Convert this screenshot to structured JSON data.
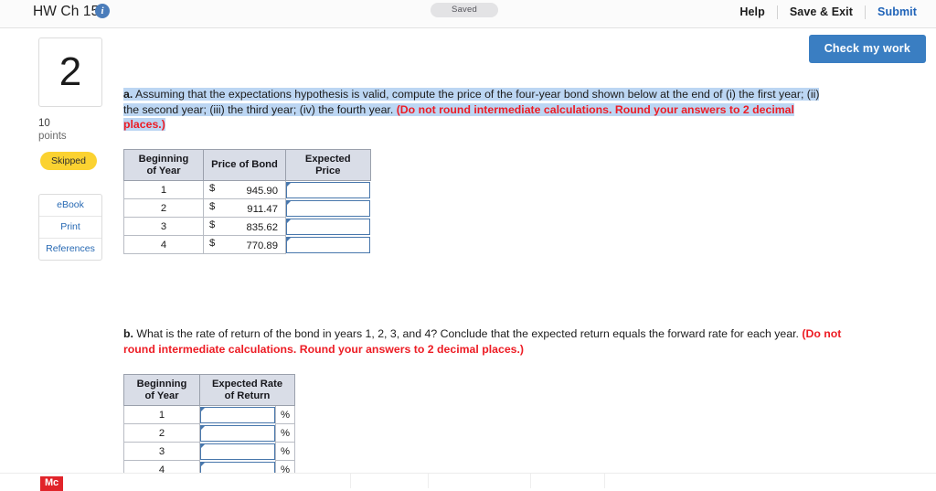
{
  "header": {
    "title": "HW Ch 15",
    "info_icon": "info-icon",
    "status_pill": "Saved",
    "actions": [
      {
        "label": "Help",
        "style": "dark"
      },
      {
        "label": "Save & Exit",
        "style": "dark"
      },
      {
        "label": "Submit",
        "style": "blue"
      }
    ]
  },
  "toolbar": {
    "check_my_work_label": "Check my work",
    "accent_color": "#3a7ec2"
  },
  "sidebar": {
    "question_number": "2",
    "points_value": "10",
    "points_label": "points",
    "status_badge": "Skipped",
    "status_badge_color": "#fbd231",
    "links": [
      {
        "label": "eBook"
      },
      {
        "label": "Print"
      },
      {
        "label": "References"
      }
    ]
  },
  "parts": {
    "a": {
      "label": "a.",
      "body": " Assuming that the expectations hypothesis is valid, compute the price of the four-year bond shown below at the end of (i) the first year; (ii) the second year; (iii) the third year; (iv) the fourth year. ",
      "instruction": "(Do not round intermediate calculations. Round your answers to 2 decimal places.)",
      "highlighted": true
    },
    "b": {
      "label": "b.",
      "body": " What is the rate of return of the bond in years 1, 2, 3, and 4? Conclude that the expected return equals the forward rate for each year. ",
      "instruction": "(Do not round intermediate calculations. Round your answers to 2 decimal places.)",
      "highlighted": false
    }
  },
  "table_a": {
    "headers": [
      "Beginning of Year",
      "Price of Bond",
      "Expected Price"
    ],
    "header_lines": [
      [
        "Beginning",
        "of Year"
      ],
      [
        "Price of Bond"
      ],
      [
        "Expected Price"
      ]
    ],
    "currency_symbol": "$",
    "rows": [
      {
        "year": "1",
        "price": "945.90",
        "expected_price": ""
      },
      {
        "year": "2",
        "price": "911.47",
        "expected_price": ""
      },
      {
        "year": "3",
        "price": "835.62",
        "expected_price": ""
      },
      {
        "year": "4",
        "price": "770.89",
        "expected_price": ""
      }
    ]
  },
  "table_b": {
    "headers": [
      "Beginning of Year",
      "Expected Rate of Return"
    ],
    "header_lines": [
      [
        "Beginning",
        "of Year"
      ],
      [
        "Expected Rate",
        "of Return"
      ]
    ],
    "percent_symbol": "%",
    "rows": [
      {
        "year": "1",
        "rate": ""
      },
      {
        "year": "2",
        "rate": ""
      },
      {
        "year": "3",
        "rate": ""
      },
      {
        "year": "4",
        "rate": ""
      }
    ]
  },
  "footer": {
    "logo_text": "Mc",
    "logo_color": "#e1242a"
  }
}
